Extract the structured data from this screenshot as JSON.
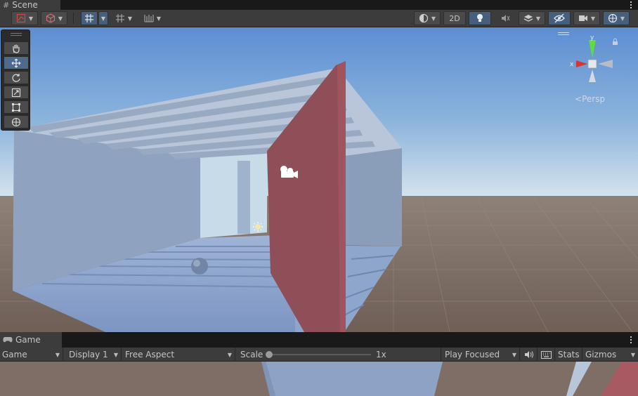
{
  "scene_tab": {
    "label": "Scene",
    "icon": "grid-hash-icon"
  },
  "scene_toolbar": {
    "mode_2d_label": "2D"
  },
  "tools": [
    "hand-tool",
    "move-tool",
    "rotate-tool",
    "scale-tool",
    "rect-tool",
    "transform-tool"
  ],
  "gizmo": {
    "y_label": "y",
    "x_label": "x",
    "projection_label": "Persp"
  },
  "game_tab": {
    "label": "Game",
    "icon": "gamepad-icon"
  },
  "game_toolbar": {
    "view_select": "Game",
    "display_select": "Display 1",
    "aspect_select": "Free Aspect",
    "scale_label": "Scale",
    "scale_value_label": "1x",
    "scale_value": 1,
    "play_mode_select": "Play Focused",
    "stats_label": "Stats",
    "gizmos_label": "Gizmos"
  },
  "colors": {
    "panel_bg": "#3c3c3c",
    "active_blue": "#46607c",
    "red_wall": "#8e4f58",
    "structure_blue": "#8aa0c0",
    "ground": "#7f6e65",
    "sky_top": "#5f8fd0",
    "horizon": "#cfe0ee"
  }
}
